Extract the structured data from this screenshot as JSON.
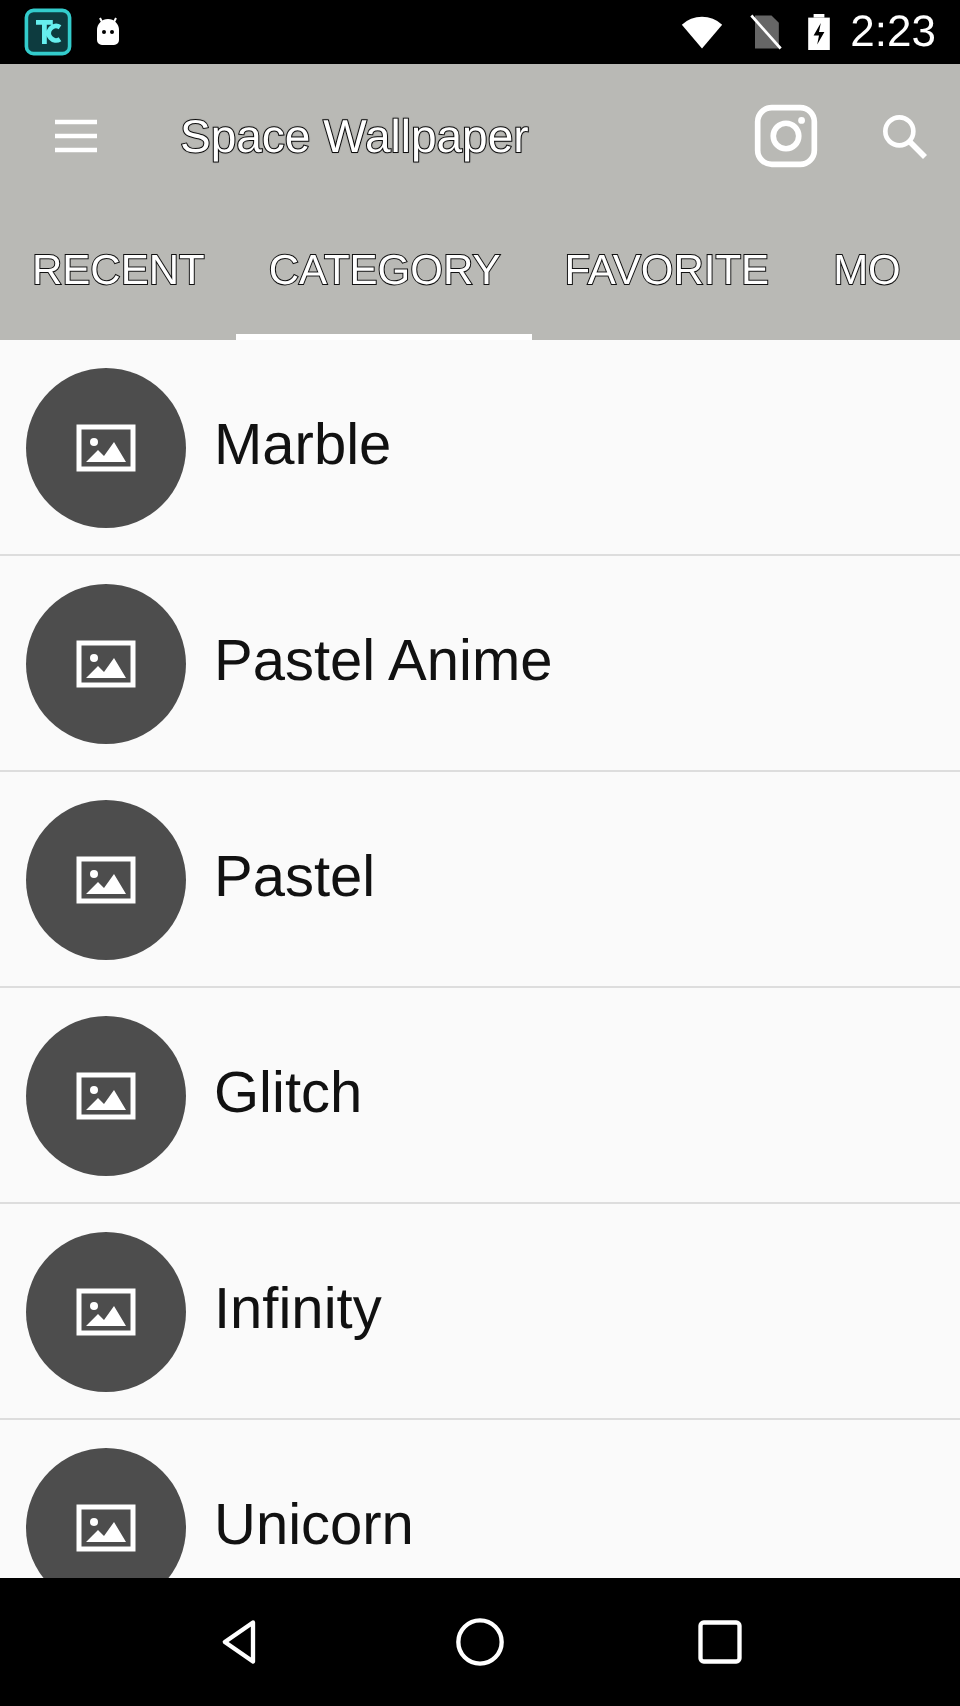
{
  "status_bar": {
    "time": "2:23"
  },
  "app_bar": {
    "title": "Space Wallpaper"
  },
  "tabs": [
    {
      "label": "RECENT",
      "selected": false
    },
    {
      "label": "CATEGORY",
      "selected": true
    },
    {
      "label": "FAVORITE",
      "selected": false
    },
    {
      "label": "MO",
      "selected": false
    }
  ],
  "categories": [
    {
      "name": "Marble"
    },
    {
      "name": "Pastel Anime"
    },
    {
      "name": "Pastel"
    },
    {
      "name": "Glitch"
    },
    {
      "name": "Infinity"
    },
    {
      "name": "Unicorn"
    }
  ]
}
